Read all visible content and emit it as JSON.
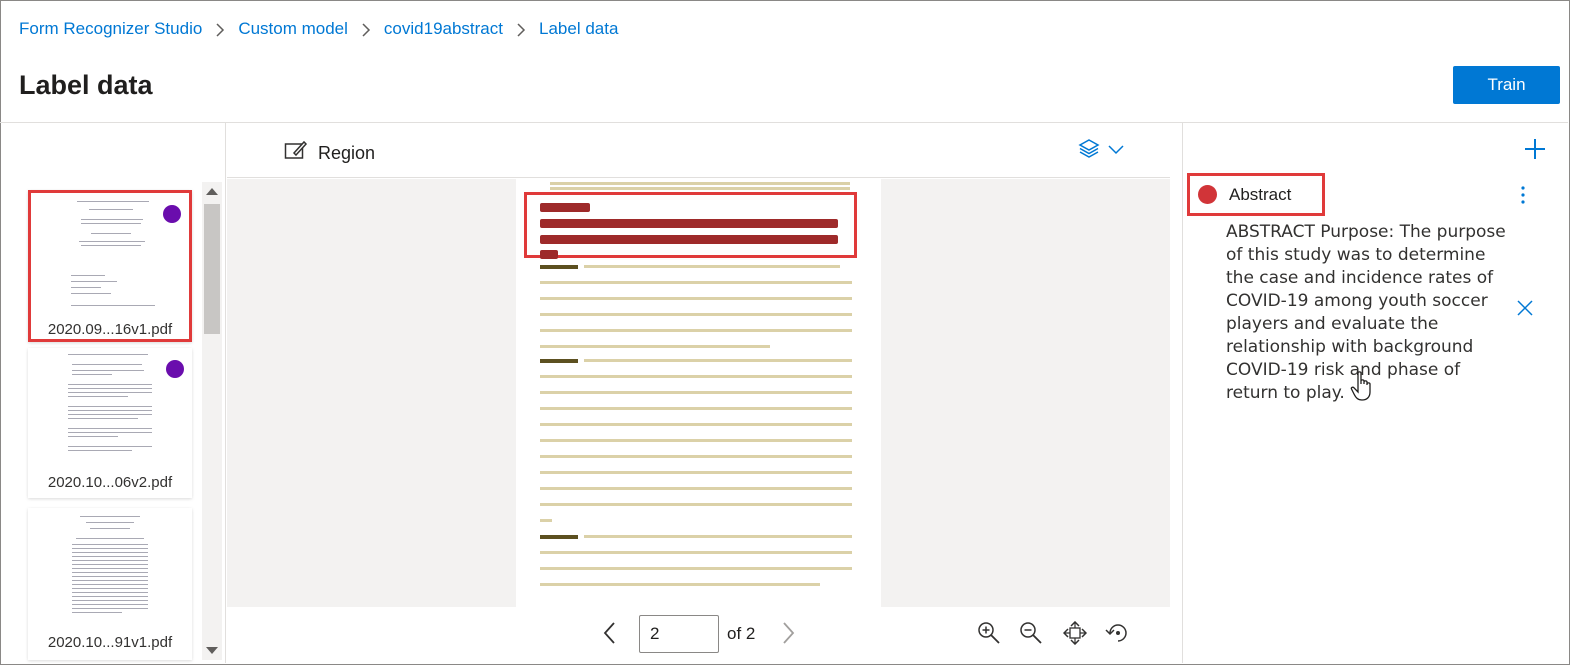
{
  "breadcrumb": {
    "items": [
      "Form Recognizer Studio",
      "Custom model",
      "covid19abstract",
      "Label data"
    ]
  },
  "header": {
    "title": "Label data",
    "train_label": "Train"
  },
  "files": {
    "items": [
      {
        "name": "2020.09...16v1.pdf",
        "labeled": true,
        "selected": true
      },
      {
        "name": "2020.10...06v2.pdf",
        "labeled": true,
        "selected": false
      },
      {
        "name": "2020.10...91v1.pdf",
        "labeled": false,
        "selected": false
      }
    ]
  },
  "viewer": {
    "region_label": "Region",
    "layers_icon": "layers-icon",
    "page_current": "2",
    "page_of": "of 2"
  },
  "labels": {
    "items": [
      {
        "name": "Abstract",
        "color": "#d13438",
        "value": "ABSTRACT Purpose: The purpose of this study was to determine the case and incidence rates of COVID-19 among youth soccer players and evaluate the relationship with background COVID-19 risk and phase of return to play."
      }
    ]
  },
  "colors": {
    "accent": "#0078d4",
    "highlight_border": "#e03a3a",
    "labeled_dot": "#6a0dad"
  }
}
